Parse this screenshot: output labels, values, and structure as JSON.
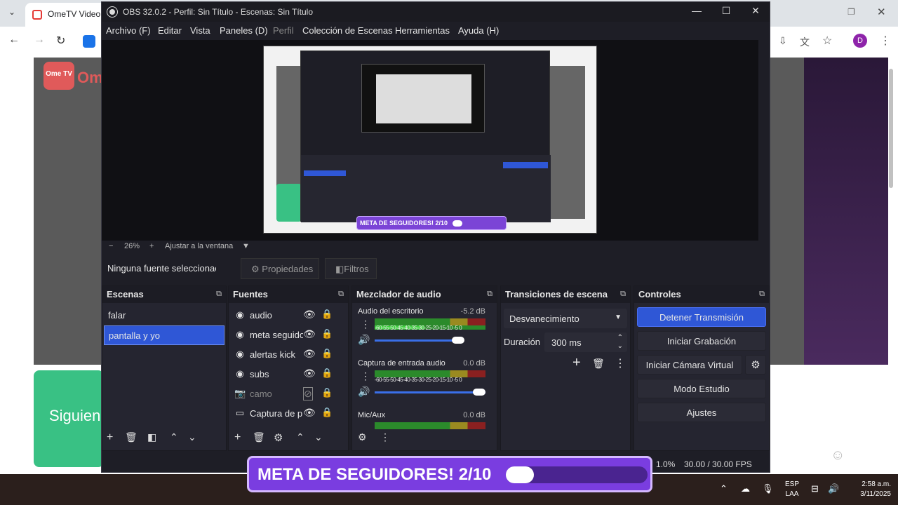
{
  "browser": {
    "tab_title": "OmeTV Video C",
    "avatar_letter": "D",
    "side_button": "Siguien",
    "ome_logo": "Ome TV",
    "ome_text": "Om"
  },
  "obs": {
    "title": "OBS 32.0.2 - Perfil: Sin Título - Escenas: Sin Título",
    "menu": [
      "Archivo (F)",
      "Editar",
      "Vista",
      "Paneles (D)",
      "Perfil",
      "Colección de Escenas",
      "Herramientas",
      "Ayuda (H)"
    ],
    "zoom": {
      "minus": "−",
      "value": "26%",
      "plus": "+",
      "fit_label": "Ajustar a la ventana"
    },
    "source_bar": {
      "no_source": "Ninguna fuente seleccionac",
      "properties": "Propiedades",
      "filters": "Filtros"
    },
    "scenes": {
      "title": "Escenas",
      "items": [
        "falar",
        "pantalla y yo"
      ],
      "selected": 1
    },
    "sources": {
      "title": "Fuentes",
      "items": [
        {
          "name": "audio",
          "icon": "speaker-icon",
          "visible": true
        },
        {
          "name": "meta seguido",
          "icon": "globe-icon",
          "visible": true
        },
        {
          "name": "alertas kick",
          "icon": "globe-icon",
          "visible": true
        },
        {
          "name": "subs",
          "icon": "globe-icon",
          "visible": true
        },
        {
          "name": "camo",
          "icon": "camera-icon",
          "visible": false
        },
        {
          "name": "Captura de p",
          "icon": "monitor-icon",
          "visible": true
        }
      ]
    },
    "mixer": {
      "title": "Mezclador de audio",
      "channels": [
        {
          "name": "Audio del escritorio",
          "db": "-5.2 dB",
          "level": 0.78
        },
        {
          "name": "Captura de entrada audio",
          "db": "0.0 dB",
          "level": 1.0
        },
        {
          "name": "Mic/Aux",
          "db": "0.0 dB",
          "level": 1.0
        }
      ],
      "scale": "-60-55-50-45-40-35-30-25-20-15-10 -5 0"
    },
    "transitions": {
      "title": "Transiciones de escena",
      "type": "Desvanecimiento",
      "duration_label": "Duración",
      "duration": "300 ms"
    },
    "controls": {
      "title": "Controles",
      "stop_stream": "Detener Transmisión",
      "start_record": "Iniciar Grabación",
      "virtual_cam": "Iniciar Cámara Virtual",
      "studio": "Modo Estudio",
      "settings": "Ajustes"
    },
    "status": {
      "cpu": "1.0%",
      "fps": "30.00 / 30.00 FPS"
    }
  },
  "overlay": {
    "text": "META DE SEGUIDORES! 2/10",
    "progress": 0.2,
    "preview_text": "META DE SEGUIDORES! 2/10"
  },
  "taskbar": {
    "lang1": "ESP",
    "lang2": "LAA",
    "time": "2:58 a.m.",
    "date": "3/11/2025"
  },
  "colors": {
    "accent": "#2f57d6",
    "overlay": "#7a3de0"
  }
}
